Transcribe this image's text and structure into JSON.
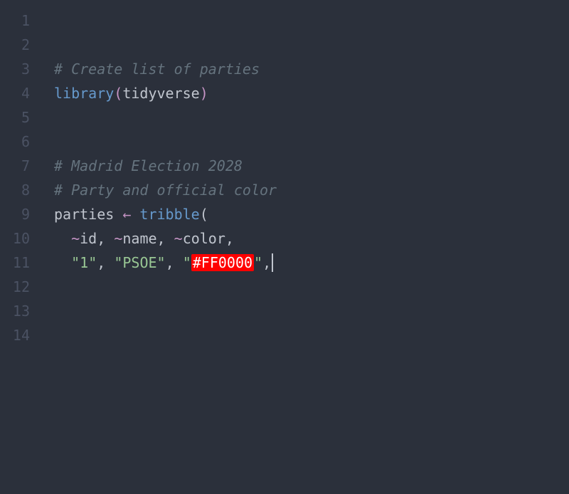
{
  "lineNumbers": [
    "1",
    "2",
    "3",
    "4",
    "5",
    "6",
    "7",
    "8",
    "9",
    "10",
    "11",
    "12",
    "13",
    "14"
  ],
  "code": {
    "line3": {
      "comment": "# Create list of parties"
    },
    "line4": {
      "func": "library",
      "paren_open": "(",
      "arg": "tidyverse",
      "paren_close": ")"
    },
    "line7": {
      "comment": "# Madrid Election 2028"
    },
    "line8": {
      "comment": "# Party and official color"
    },
    "line9": {
      "var": "parties",
      "assign": " ← ",
      "func": "tribble",
      "paren_open": "("
    },
    "line10": {
      "indent": "  ",
      "tilde1": "~",
      "id1": "id",
      "comma1": ", ",
      "tilde2": "~",
      "id2": "name",
      "comma2": ", ",
      "tilde3": "~",
      "id3": "color",
      "comma3": ","
    },
    "line11": {
      "indent": "  ",
      "quote1_open": "\"",
      "val1": "1",
      "quote1_close": "\"",
      "comma1": ", ",
      "quote2_open": "\"",
      "val2": "PSOE",
      "quote2_close": "\"",
      "comma2": ", ",
      "quote3_open": "\"",
      "val3": "#FF0000",
      "quote3_close": "\"",
      "comma3": ","
    }
  }
}
